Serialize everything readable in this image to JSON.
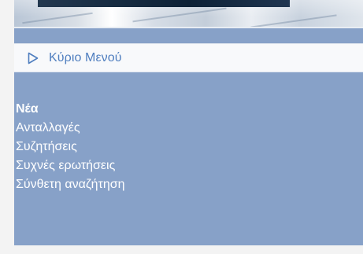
{
  "main_menu": {
    "label": "Κύριο Μενού",
    "icon": "triangle-right-icon"
  },
  "nav": {
    "items": [
      {
        "label": "Νέα",
        "active": true
      },
      {
        "label": "Ανταλλαγές",
        "active": false
      },
      {
        "label": "Συζητήσεις",
        "active": false
      },
      {
        "label": "Συχνές ερωτήσεις",
        "active": false
      },
      {
        "label": "Σύνθετη αναζήτηση",
        "active": false
      }
    ]
  },
  "colors": {
    "panel": "#87a1c8",
    "menu_text": "#4f7ebf",
    "nav_text": "#ffffff"
  }
}
